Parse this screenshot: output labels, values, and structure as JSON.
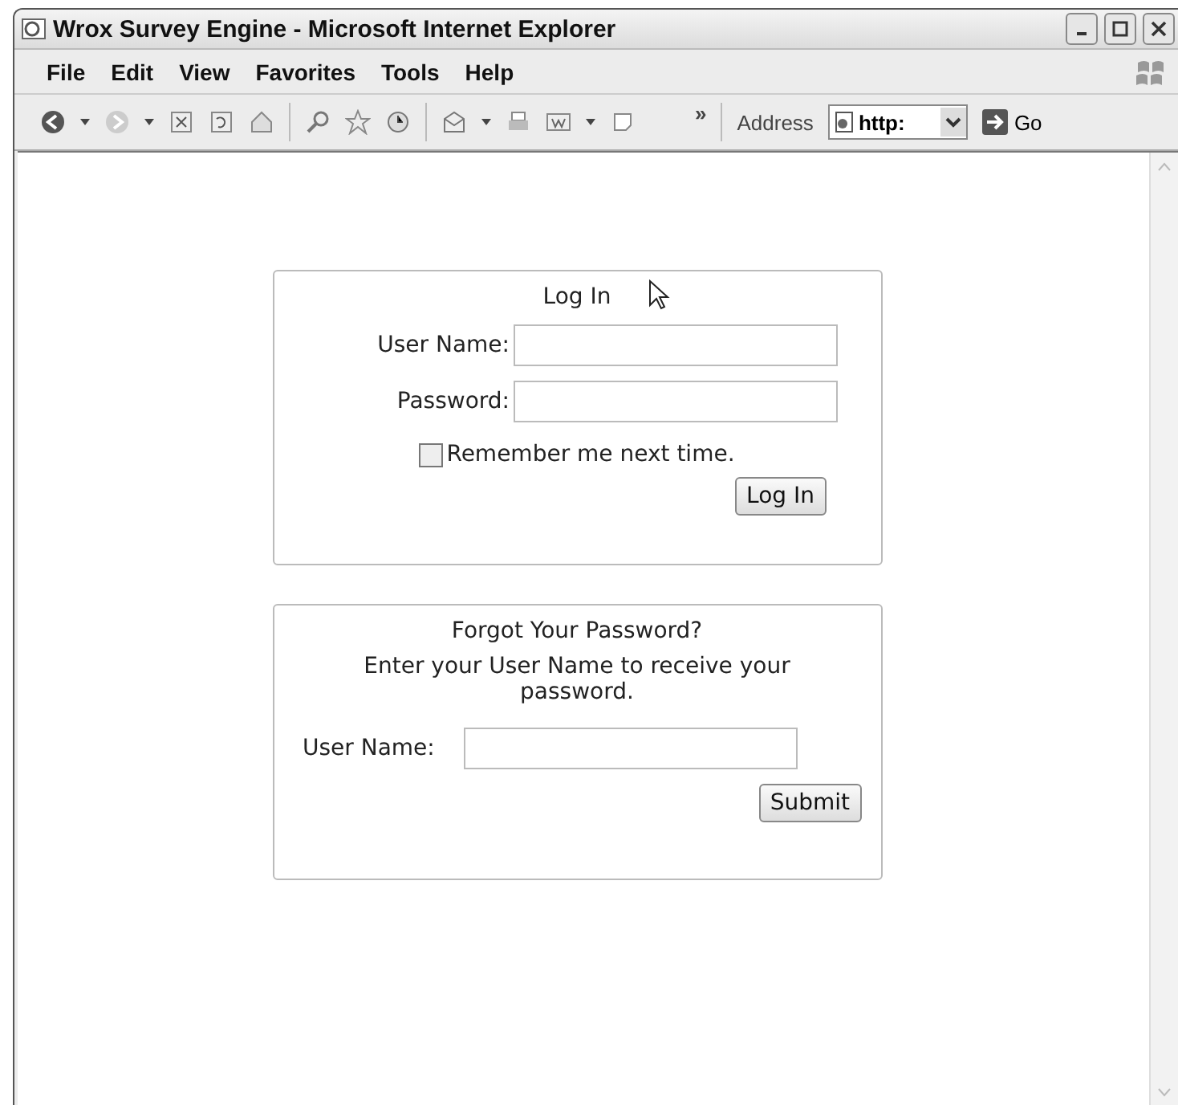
{
  "window": {
    "title": "Wrox Survey Engine - Microsoft Internet Explorer"
  },
  "menu": [
    "File",
    "Edit",
    "View",
    "Favorites",
    "Tools",
    "Help"
  ],
  "toolbar": {
    "more": "»",
    "address_label": "Address",
    "address_value": "http:",
    "go": "Go"
  },
  "login": {
    "title": "Log In",
    "user_label": "User Name:",
    "password_label": "Password:",
    "remember": {
      "label": "Remember me next time.",
      "checked": false
    },
    "button": "Log In"
  },
  "recover": {
    "title": "Forgot Your Password?",
    "instructions": "Enter your User Name to receive your password.",
    "user_label": "User Name:",
    "button": "Submit"
  }
}
